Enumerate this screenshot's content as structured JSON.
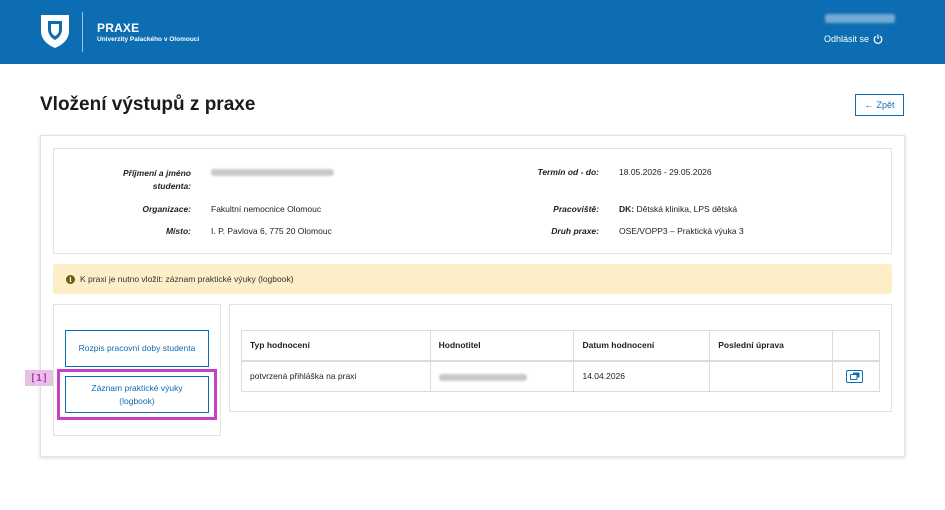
{
  "header": {
    "brand_title": "PRAXE",
    "brand_subtitle": "Univerzity Palackého v Olomouci",
    "logout_label": "Odhlásit se",
    "brand_color": "#0d6db2"
  },
  "page": {
    "title": "Vložení výstupů z praxe",
    "back_label": "Zpět"
  },
  "info": {
    "student_label": "Příjmení a jméno studenta:",
    "organization_label": "Organizace:",
    "organization_value": "Fakultní nemocnice Olomouc",
    "place_label": "Místo:",
    "place_value": "I. P. Pavlova 6, 775 20 Olomouc",
    "term_label": "Termín od - do:",
    "term_value": "18.05.2026 - 29.05.2026",
    "workplace_label": "Pracoviště:",
    "workplace_code": "DK:",
    "workplace_value": "Dětská klinika, LPS dětská",
    "type_label": "Druh praxe:",
    "type_value": "OSE/VOPP3 – Praktická výuka 3"
  },
  "alert": {
    "text": "K praxi je nutno vložit: záznam praktické výuky (logbook)"
  },
  "side": {
    "btn1": "Rozpis pracovní doby studenta",
    "btn2": "Záznam praktické výuky (logbook)",
    "highlight_tag": "[1]"
  },
  "table": {
    "headers": [
      "Typ hodnocení",
      "Hodnotitel",
      "Datum hodnocení",
      "Poslední úprava"
    ],
    "rows": [
      {
        "type": "potvrzená přihláška na praxi",
        "date": "14.04.2026",
        "last_edit": ""
      }
    ]
  }
}
